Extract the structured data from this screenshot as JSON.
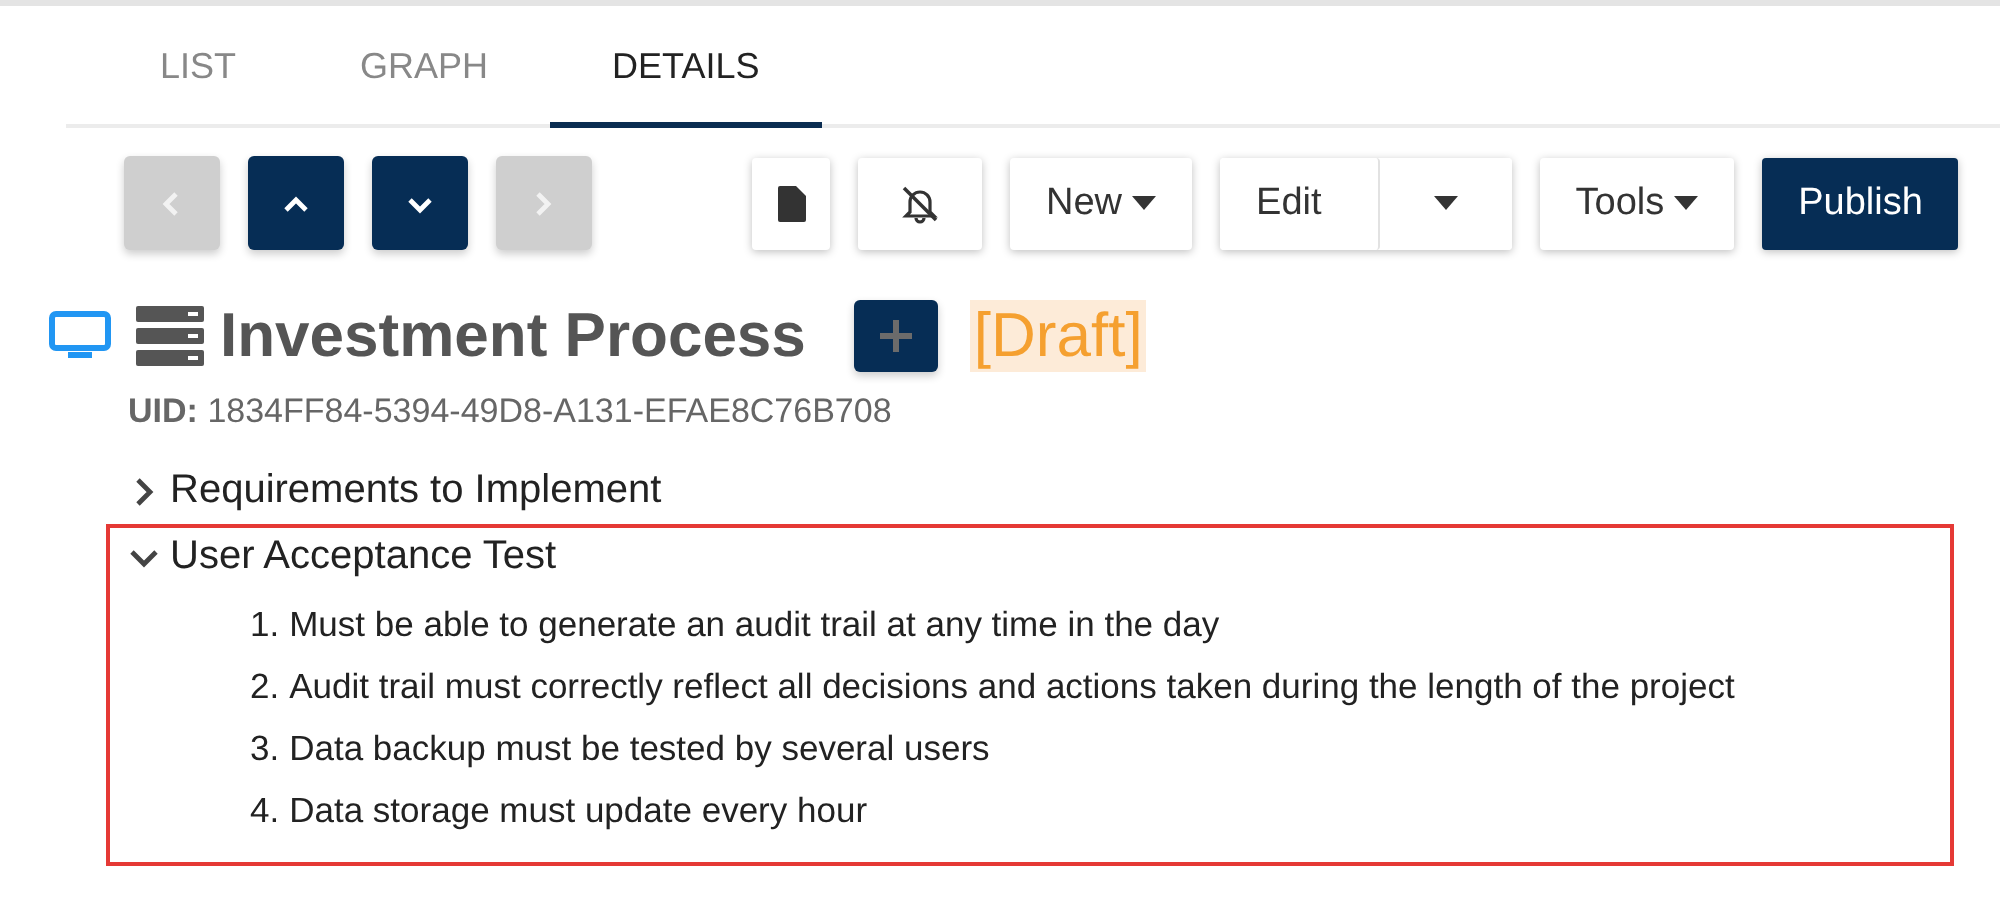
{
  "tabs": [
    {
      "label": "LIST",
      "selected": false
    },
    {
      "label": "GRAPH",
      "selected": false
    },
    {
      "label": "DETAILS",
      "selected": true
    }
  ],
  "nav_buttons": [
    {
      "kind": "prev",
      "disabled": true
    },
    {
      "kind": "up",
      "disabled": false
    },
    {
      "kind": "down",
      "disabled": false
    },
    {
      "kind": "next",
      "disabled": true
    }
  ],
  "toolbar": [
    {
      "kind": "document"
    },
    {
      "kind": "bell-off"
    },
    {
      "kind": "dropdown",
      "label": "New"
    },
    {
      "kind": "split",
      "label": "Edit"
    },
    {
      "kind": "dropdown",
      "label": "Tools"
    },
    {
      "kind": "primary",
      "label": "Publish"
    }
  ],
  "header": {
    "title": "Investment Process",
    "status": "[Draft]",
    "uid_label": "UID:",
    "uid": "1834FF84-5394-49D8-A131-EFAE8C76B708"
  },
  "sections": [
    {
      "title": "Requirements to Implement",
      "expanded": false,
      "highlighted": false
    },
    {
      "title": "User Acceptance Test",
      "expanded": true,
      "highlighted": true,
      "items": [
        {
          "number": "1.",
          "text": "Must be able to generate an audit trail at any time in the day"
        },
        {
          "number": "2.",
          "text": "Audit trail must correctly reflect all decisions and actions taken during the length of the project"
        },
        {
          "number": "3.",
          "text": "Data backup must be tested by several users"
        },
        {
          "number": "4.",
          "text": "Data storage must update every hour"
        }
      ]
    }
  ]
}
